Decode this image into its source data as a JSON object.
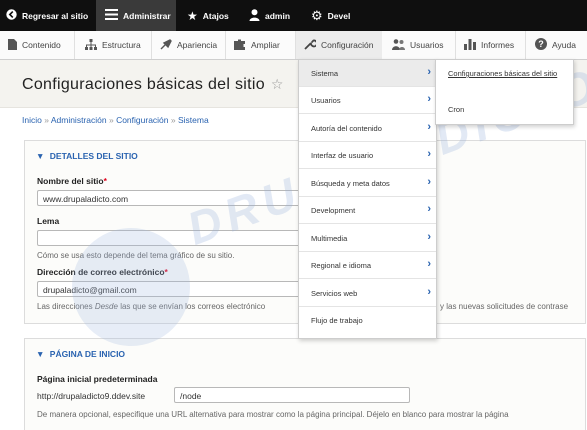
{
  "toolbar": {
    "back": "Regresar al sitio",
    "admin": "Administrar",
    "shortcuts": "Atajos",
    "user": "admin",
    "devel": "Devel"
  },
  "tray": {
    "items": [
      "Contenido",
      "Estructura",
      "Apariencia",
      "Ampliar",
      "Configuración",
      "Usuarios",
      "Informes",
      "Ayuda"
    ]
  },
  "page": {
    "title": "Configuraciones básicas del sitio",
    "breadcrumb": [
      "Inicio",
      "Administración",
      "Configuración",
      "Sistema"
    ]
  },
  "site_details": {
    "summary": "DETALLES DEL SITIO",
    "name_label": "Nombre del sitio",
    "name_value": "www.drupaladicto.com",
    "slogan_label": "Lema",
    "slogan_value": "",
    "slogan_hint": "Cómo se usa esto depende del tema gráfico de su sitio.",
    "email_label": "Dirección de correo electrónico",
    "email_value": "drupaladicto@gmail.com",
    "email_hint_pre": "Las direcciones",
    "email_hint_em": "Desde",
    "email_hint_post": "las que se envían los correos electrónico",
    "email_hint_tail": "y las nuevas solicitudes de contrase"
  },
  "front_page": {
    "summary": "PÁGINA DE INICIO",
    "label": "Página inicial predeterminada",
    "prefix": "http://drupaladicto9.ddev.site",
    "value": "/node",
    "hint": "De manera opcional, especifique una URL alternativa para mostrar como la página principal. Déjelo en blanco para mostrar la página"
  },
  "menu": {
    "items": [
      {
        "label": "Sistema",
        "arrow": true
      },
      {
        "label": "Usuarios",
        "arrow": true
      },
      {
        "label": "Autoría del contenido",
        "arrow": true
      },
      {
        "label": "Interfaz de usuario",
        "arrow": true
      },
      {
        "label": "Búsqueda y meta datos",
        "arrow": true
      },
      {
        "label": "Development",
        "arrow": true
      },
      {
        "label": "Multimedia",
        "arrow": true
      },
      {
        "label": "Regional e idioma",
        "arrow": true
      },
      {
        "label": "Servicios web",
        "arrow": true
      },
      {
        "label": "Flujo de trabajo",
        "arrow": false
      }
    ],
    "submenu": [
      "Configuraciones básicas del sitio",
      "Cron"
    ]
  },
  "watermark": "DRUPALADICTO"
}
